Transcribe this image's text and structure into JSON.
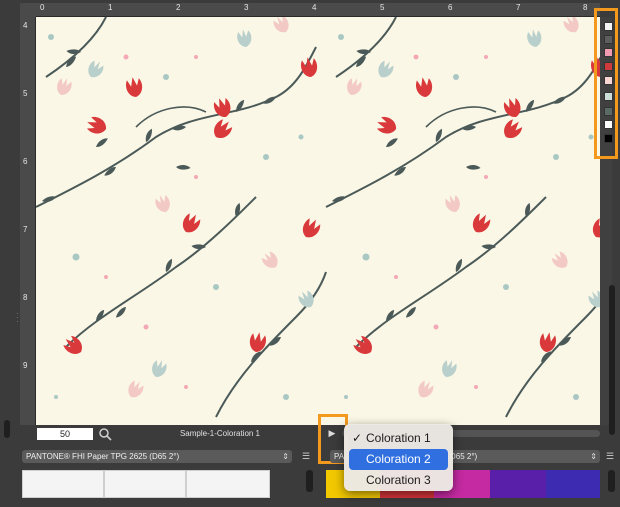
{
  "rulers": {
    "top": [
      "0",
      "1",
      "2",
      "3",
      "4",
      "5",
      "6",
      "7",
      "8"
    ],
    "left": [
      "4",
      "5",
      "6",
      "7",
      "8",
      "9"
    ]
  },
  "canvas": {
    "background": "#faf7e6",
    "pattern_colors": [
      "#d9393a",
      "#f3c9c6",
      "#a9c7c3",
      "#4b5a58",
      "#f4a8b5"
    ]
  },
  "swatch_strip": {
    "colors": [
      "#f4f4f4",
      "#5c5f5e",
      "#f19bb0",
      "#cf3b3d",
      "#f8d6d3",
      "#cdded9",
      "#5b6a66",
      "#ffffff",
      "#000000"
    ]
  },
  "zoom": {
    "value": "50"
  },
  "document": {
    "name": "Sample-1-Coloration 1"
  },
  "palette_left": {
    "label": "PANTONE® FHI Paper TPG 2625 (D65 2°)"
  },
  "palette_right": {
    "label_start": "PA",
    "label_end": "D65 2°)"
  },
  "bottom_colors": [
    "#f2c800",
    "#d6343b",
    "#c52aa2",
    "#5a1fa8",
    "#3d2bb2"
  ],
  "menu": {
    "items": [
      {
        "label": "Coloration 1",
        "checked": true,
        "selected": false
      },
      {
        "label": "Coloration 2",
        "checked": false,
        "selected": true
      },
      {
        "label": "Coloration 3",
        "checked": false,
        "selected": false
      }
    ],
    "check_glyph": "✓"
  },
  "accent": "#f39a1e"
}
